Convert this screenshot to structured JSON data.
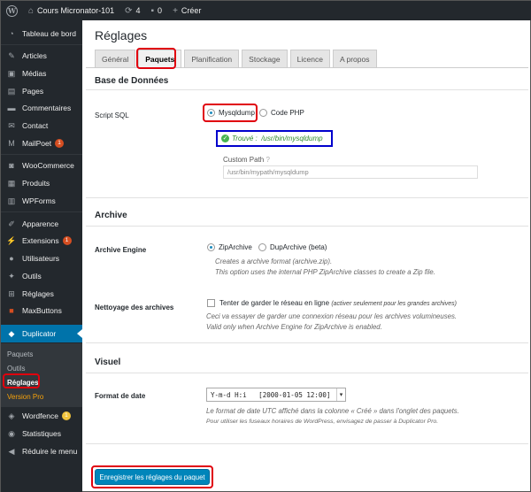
{
  "adminbar": {
    "site_name": "Cours Micronator-101",
    "updates": "4",
    "comments": "0",
    "new_label": "Créer"
  },
  "sidebar": {
    "items": [
      {
        "label": "Tableau de bord",
        "icon": "dashboard-icon"
      },
      {
        "label": "Articles",
        "icon": "pin-icon"
      },
      {
        "label": "Médias",
        "icon": "media-icon"
      },
      {
        "label": "Pages",
        "icon": "page-icon"
      },
      {
        "label": "Commentaires",
        "icon": "comment-icon"
      },
      {
        "label": "Contact",
        "icon": "mail-icon"
      },
      {
        "label": "MailPoet",
        "icon": "mailpoet-icon",
        "badge": "1"
      },
      {
        "label": "WooCommerce",
        "icon": "woocommerce-icon"
      },
      {
        "label": "Produits",
        "icon": "box-icon"
      },
      {
        "label": "WPForms",
        "icon": "form-icon"
      },
      {
        "label": "Apparence",
        "icon": "brush-icon"
      },
      {
        "label": "Extensions",
        "icon": "plugin-icon",
        "badge": "1"
      },
      {
        "label": "Utilisateurs",
        "icon": "user-icon"
      },
      {
        "label": "Outils",
        "icon": "wrench-icon"
      },
      {
        "label": "Réglages",
        "icon": "settings-icon"
      },
      {
        "label": "MaxButtons",
        "icon": "maxbuttons-icon"
      },
      {
        "label": "Duplicator",
        "icon": "duplicator-icon"
      },
      {
        "label": "Wordfence",
        "icon": "wordfence-icon",
        "badge": "1"
      },
      {
        "label": "Statistiques",
        "icon": "stats-icon"
      },
      {
        "label": "Réduire le menu",
        "icon": "collapse-icon"
      }
    ],
    "submenu": [
      "Paquets",
      "Outils",
      "Réglages",
      "Version Pro"
    ]
  },
  "page": {
    "title": "Réglages",
    "tabs": [
      "Général",
      "Paquets",
      "Planification",
      "Stockage",
      "Licence",
      "A propos"
    ],
    "active_tab": "Paquets"
  },
  "database": {
    "title": "Base de Données",
    "script_label": "Script SQL",
    "option_mysqldump": "Mysqldump",
    "option_php": "Code PHP",
    "found_label": "Trouvé :",
    "found_path": "/usr/bin/mysqldump",
    "custom_path_label": "Custom Path",
    "custom_path_placeholder": "/usr/bin/mypath/mysqldump"
  },
  "archive": {
    "title": "Archive",
    "engine_label": "Archive Engine",
    "option_zip": "ZipArchive",
    "option_dup": "DupArchive (beta)",
    "desc1": "Creates a archive format (archive.zip).",
    "desc2": "This option uses the internal PHP ZipArchive classes to create a Zip file.",
    "cleanup_label": "Nettoyage des archives",
    "cleanup_checkbox": "Tenter de garder le réseau en ligne",
    "cleanup_note": "(activer seulement pour les grandes archives)",
    "cleanup_desc1": "Ceci va essayer de garder une connexion réseau pour les archives volumineuses.",
    "cleanup_desc2": "Valid only when Archive Engine for ZipArchive is enabled."
  },
  "visuel": {
    "title": "Visuel",
    "date_label": "Format de date",
    "date_value": "Y-m-d H:i   [2000-01-05 12:00]",
    "desc1": "Le format de date UTC affiché dans la colonne « Créé » dans l'onglet des paquets.",
    "desc2": "Pour utiliser les fuseaux horaires de WordPress, envisagez de passer à Duplicator Pro."
  },
  "save_button": "Enregistrer les réglages du paquet"
}
